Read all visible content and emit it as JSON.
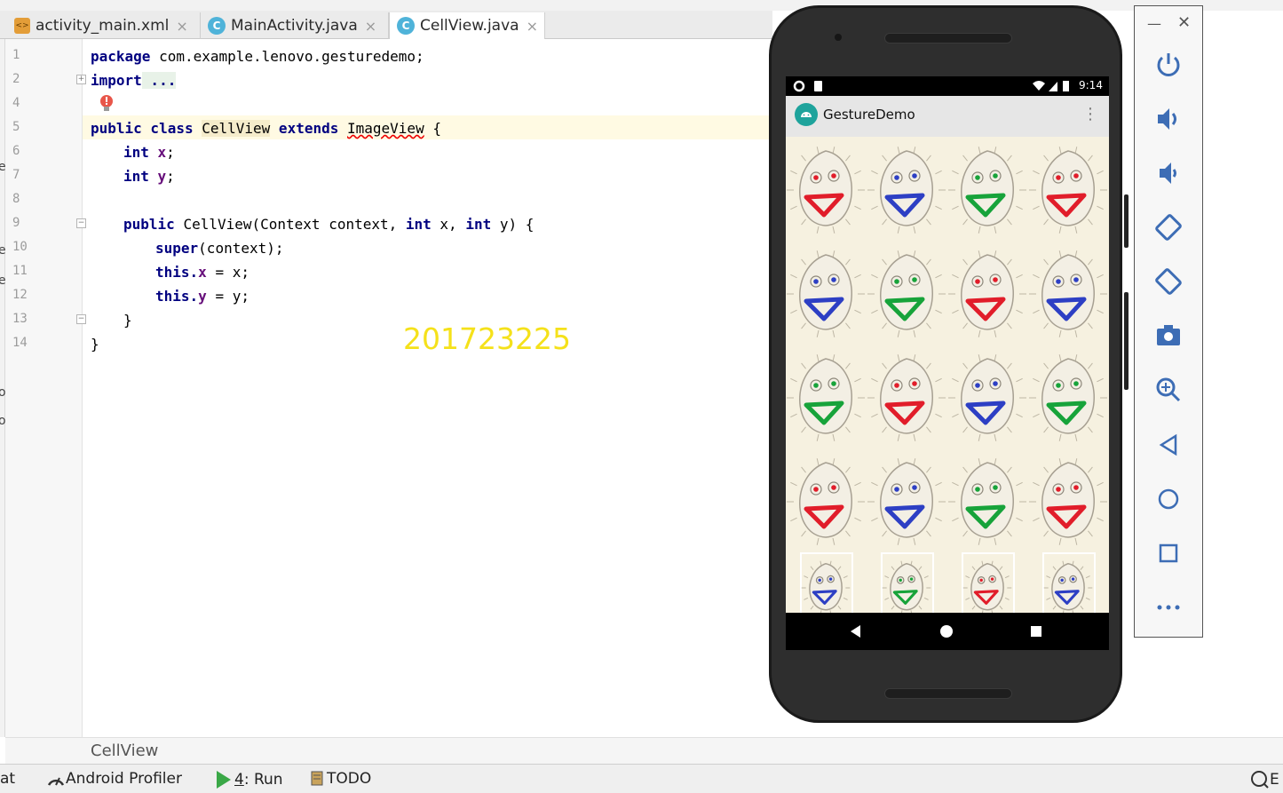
{
  "tabs": [
    {
      "label": "activity_main.xml",
      "type": "xml"
    },
    {
      "label": "MainActivity.java",
      "type": "java"
    },
    {
      "label": "CellView.java",
      "type": "java",
      "active": true
    }
  ],
  "line_numbers": [
    "1",
    "2",
    "4",
    "5",
    "6",
    "7",
    "8",
    "9",
    "10",
    "11",
    "12",
    "13",
    "14"
  ],
  "code": {
    "l1_kw": "package",
    "l1_rest": " com.example.lenovo.gesturedemo;",
    "l2_kw": "import",
    "l2_fold": " ...",
    "l5_kw1": "public class ",
    "l5_cls": "CellView",
    "l5_kw2": " extends ",
    "l5_base": "ImageView",
    "l5_end": " {",
    "l6_kw": "int ",
    "l6_f": "x",
    "l6_end": ";",
    "l7_kw": "int ",
    "l7_f": "y",
    "l7_end": ";",
    "l9_kw": "public ",
    "l9_a": "CellView(Context context, ",
    "l9_kw2": "int ",
    "l9_b": "x, ",
    "l9_kw3": "int ",
    "l9_c": "y) {",
    "l10_kw": "super",
    "l10_rest": "(context);",
    "l11_kw": "this.",
    "l11_f": "x",
    "l11_rest": " = x;",
    "l12_kw": "this.",
    "l12_f": "y",
    "l12_rest": " = y;",
    "l13": "}",
    "l14": "}"
  },
  "watermark": "201723225",
  "breadcrumb": "CellView",
  "statusbar": {
    "left_fragment": "at",
    "profiler": "Android Profiler",
    "run_num": "4",
    "run_label": ": Run",
    "todo": "TODO",
    "right_fragment": "E"
  },
  "emulator": {
    "time": "9:14",
    "app_title": "GestureDemo",
    "face_colors": [
      [
        "red",
        "blue",
        "green",
        "red"
      ],
      [
        "blue",
        "green",
        "red",
        "blue"
      ],
      [
        "green",
        "red",
        "blue",
        "green"
      ],
      [
        "red",
        "blue",
        "green",
        "red"
      ],
      [
        "blue",
        "green",
        "red",
        "blue"
      ]
    ],
    "colors": {
      "red": "#e11d2a",
      "blue": "#2d3fc4",
      "green": "#17a33a"
    }
  },
  "toolbar_icons": [
    "power-icon",
    "volume-up-icon",
    "volume-down-icon",
    "rotate-left-icon",
    "rotate-right-icon",
    "camera-icon",
    "zoom-icon",
    "back-icon",
    "home-icon",
    "overview-icon",
    "more-icon"
  ]
}
